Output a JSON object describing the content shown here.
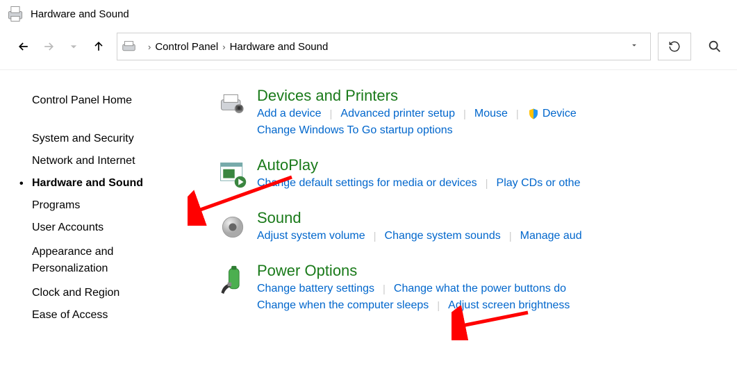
{
  "window": {
    "title": "Hardware and Sound"
  },
  "breadcrumb": {
    "item0": "Control Panel",
    "item1": "Hardware and Sound"
  },
  "sidebar": {
    "items": [
      {
        "label": "Control Panel Home"
      },
      {
        "label": "System and Security"
      },
      {
        "label": "Network and Internet"
      },
      {
        "label": "Hardware and Sound"
      },
      {
        "label": "Programs"
      },
      {
        "label": "User Accounts"
      },
      {
        "label": "Appearance and\nPersonalization"
      },
      {
        "label": "Clock and Region"
      },
      {
        "label": "Ease of Access"
      }
    ]
  },
  "categories": {
    "devices": {
      "title": "Devices and Printers",
      "tasks": [
        "Add a device",
        "Advanced printer setup",
        "Mouse",
        "Device",
        "Change Windows To Go startup options"
      ]
    },
    "autoplay": {
      "title": "AutoPlay",
      "tasks": [
        "Change default settings for media or devices",
        "Play CDs or othe"
      ]
    },
    "sound": {
      "title": "Sound",
      "tasks": [
        "Adjust system volume",
        "Change system sounds",
        "Manage aud"
      ]
    },
    "power": {
      "title": "Power Options",
      "tasks": [
        "Change battery settings",
        "Change what the power buttons do",
        "Change when the computer sleeps",
        "Adjust screen brightness"
      ]
    }
  }
}
